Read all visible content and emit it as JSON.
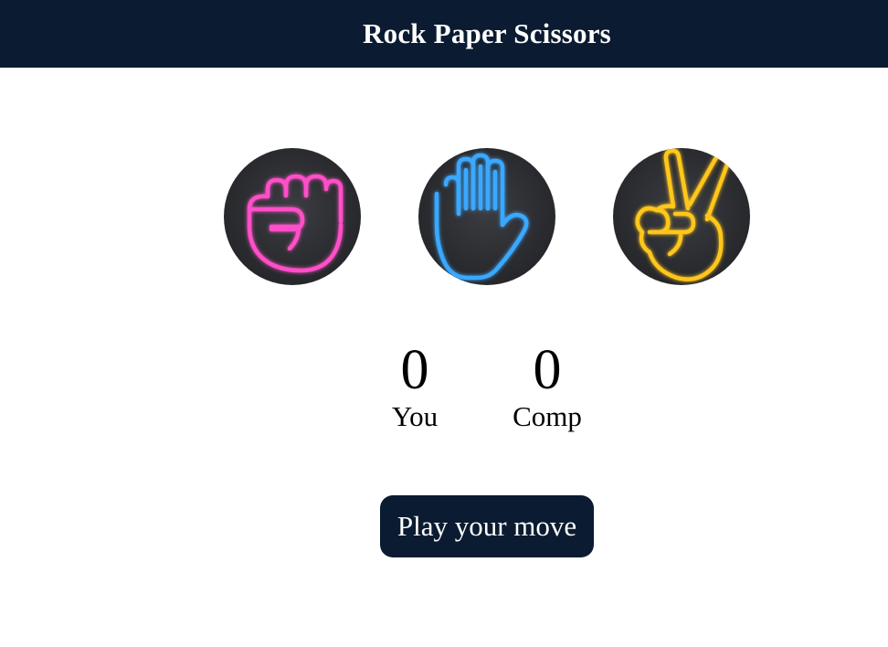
{
  "header": {
    "title": "Rock Paper Scissors"
  },
  "choices": [
    {
      "id": "rock",
      "icon": "rock-fist-icon",
      "color": "#ff4fc8"
    },
    {
      "id": "paper",
      "icon": "paper-hand-icon",
      "color": "#3aa8ff"
    },
    {
      "id": "scissors",
      "icon": "scissors-hand-icon",
      "color": "#ffc61a"
    }
  ],
  "scoreboard": {
    "user_score": "0",
    "user_label": "You",
    "comp_score": "0",
    "comp_label": "Comp"
  },
  "message": {
    "text": "Play your move"
  },
  "colors": {
    "header_bg": "#0b1b31",
    "button_bg": "#0b1b31"
  }
}
